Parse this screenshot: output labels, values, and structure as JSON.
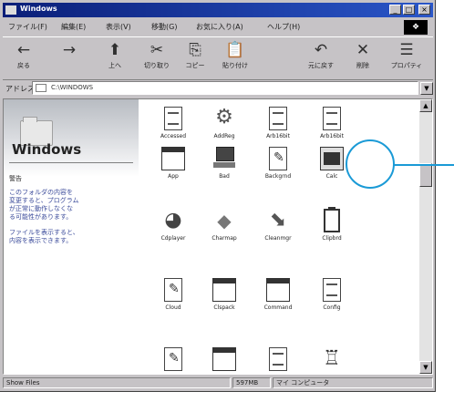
{
  "window": {
    "title": "Windows",
    "buttons": {
      "minimize": "_",
      "maximize": "□",
      "close": "×"
    }
  },
  "menu": {
    "items": [
      "ファイル(F)",
      "編集(E)",
      "表示(V)",
      "移動(G)",
      "お気に入り(A)",
      "ヘルプ(H)"
    ]
  },
  "toolbar": {
    "buttons": [
      {
        "label": "戻る",
        "icon": "back-arrow-icon",
        "glyph": "←"
      },
      {
        "label": "",
        "icon": "forward-arrow-icon",
        "glyph": "→"
      },
      {
        "label": "上へ",
        "icon": "up-folder-icon",
        "glyph": "⬆"
      },
      {
        "label": "切り取り",
        "icon": "cut-icon",
        "glyph": "✂"
      },
      {
        "label": "コピー",
        "icon": "copy-icon",
        "glyph": "⎘"
      },
      {
        "label": "貼り付け",
        "icon": "paste-icon",
        "glyph": "📋"
      },
      {
        "label": "元に戻す",
        "icon": "undo-icon",
        "glyph": "↶"
      },
      {
        "label": "削除",
        "icon": "delete-icon",
        "glyph": "✕"
      },
      {
        "label": "プロパティ",
        "icon": "properties-icon",
        "glyph": "☰"
      }
    ]
  },
  "address": {
    "label": "アドレス",
    "value": "C:\\WINDOWS"
  },
  "left_panel": {
    "title": "Windows",
    "warning": "警告",
    "paragraph1": "このフォルダの内容を\n変更すると、プログラム\nが正常に動作しなくな\nる可能性があります。",
    "paragraph2": "ファイルを表示すると、\n内容を表示できます。"
  },
  "files": [
    {
      "name": "Accessed",
      "icon": "folder-doc-icon"
    },
    {
      "name": "AddReg",
      "icon": "gear-icon"
    },
    {
      "name": "Arb16bit",
      "icon": "doc-icon"
    },
    {
      "name": "Arb16bit",
      "icon": "doc-icon"
    },
    {
      "name": "App",
      "icon": "window-icon"
    },
    {
      "name": "Bad",
      "icon": "computer-icon"
    },
    {
      "name": "Backgrnd",
      "icon": "file-icon"
    },
    {
      "name": "Calc",
      "icon": "calculator-icon"
    },
    {
      "name": "Cdplayer",
      "icon": "cd-player-icon"
    },
    {
      "name": "Charmap",
      "icon": "charmap-icon"
    },
    {
      "name": "Cleanmgr",
      "icon": "paint-icon"
    },
    {
      "name": "Clipbrd",
      "icon": "clipboard-icon"
    },
    {
      "name": "Cloud",
      "icon": "file-icon"
    },
    {
      "name": "Clspack",
      "icon": "window-icon"
    },
    {
      "name": "Command",
      "icon": "window-icon"
    },
    {
      "name": "Config",
      "icon": "doc-icon"
    },
    {
      "name": "",
      "icon": "file-icon"
    },
    {
      "name": "",
      "icon": "window-icon"
    },
    {
      "name": "",
      "icon": "doc-icon"
    },
    {
      "name": "",
      "icon": "anchor-icon"
    }
  ],
  "status": {
    "left": "Show Files",
    "size": "597MB",
    "location": "マイ コンピュータ"
  },
  "colors": {
    "titlebar_start": "#0a1e78",
    "titlebar_end": "#2a56c8",
    "callout": "#1a9ad6"
  }
}
